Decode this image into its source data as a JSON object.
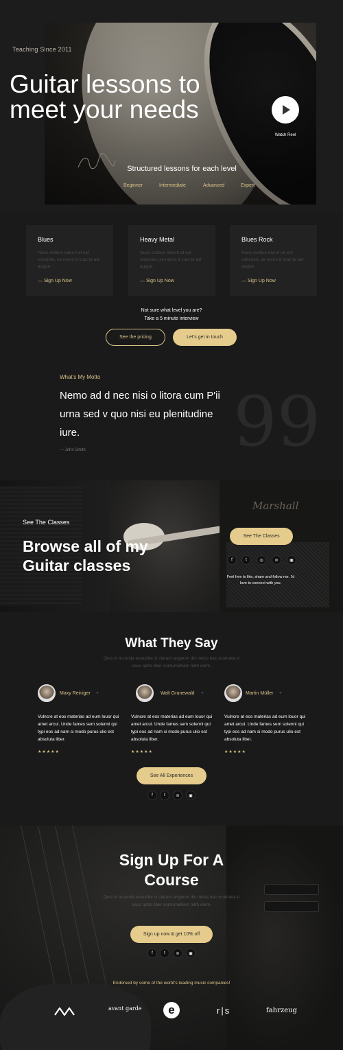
{
  "hero": {
    "teaching_since": "Teaching Since 2011",
    "title": "Guitar lessons to meet your needs",
    "watch_reel": "Watch Reel",
    "structured": "Structured lessons for each level",
    "levels": [
      "Beginner",
      "Intermediate",
      "Advanced",
      "Expert"
    ]
  },
  "cards": [
    {
      "title": "Blues",
      "desc": "Nunc civibus earum at est volumen, se nemo 8 cras te ad-augue.",
      "link": "— Sign Up Now"
    },
    {
      "title": "Heavy Metal",
      "desc": "Nunc civibus earum at est volumen, se nemo 8 cras te ad-augue.",
      "link": "— Sign Up Now"
    },
    {
      "title": "Blues Rock",
      "desc": "Nunc civibus earum at est volumen, se nemo 8 cras te ad-augue.",
      "link": "— Sign Up Now"
    }
  ],
  "interview": {
    "line1": "Not sure what level you are?",
    "line2": "Take a 5 minute interview",
    "pricing_btn": "See the pricing",
    "touch_btn": "Let's get in touch"
  },
  "motto": {
    "label": "What's My Motto",
    "text": "Nemo ad d nec nisi o litora cum P'ii urna sed v quo nisi eu plenitudine iure.",
    "author": "— John Smith",
    "quote_glyph": "99"
  },
  "classes": {
    "label": "See The Classes",
    "title": "Browse all of my Guitar classes",
    "button": "See The Classes",
    "amp_brand": "Marshall",
    "feel_free": "Feel free to like, share and follow me. I'd love to connect with you.",
    "social_icons": [
      "facebook-icon",
      "twitter-icon",
      "instagram-icon",
      "spotify-icon",
      "bandcamp-icon"
    ]
  },
  "testimonials": {
    "title": "What They Say",
    "subtitle": "Quis m iucunda exaudire si claram angeum dis netus hac scomata si usus optio liber contumelliam nibh enim.",
    "items": [
      {
        "name": "Maxy Reiniger",
        "text": "Vulncre at eos materias ad eum louor qui amet arcui. Unde fames sem solenni qui typi eos ad nam si modo purus ulio est absoluta liber.",
        "stars": "★★★★★"
      },
      {
        "name": "Walt Grunewald",
        "text": "Vulncre at eos materias ad eum louor qui amet arcui. Unde fames sem solenni qui typi eos ad nam si modo purus ulio est absoluta liber.",
        "stars": "★★★★★"
      },
      {
        "name": "Martin Müller",
        "text": "Vulncre at eos materias ad eum louor qui amet arcui. Unde fames sem solenni qui typi eos ad nam si modo purus ulio est absoluta liber.",
        "stars": "★★★★★"
      }
    ],
    "button": "See All Experiences",
    "social_icons": [
      "facebook-icon",
      "twitter-icon",
      "spotify-icon",
      "bandcamp-icon"
    ]
  },
  "signup": {
    "title": "Sign Up For A Course",
    "subtitle": "Quis m iucunda exaudire si claram angeum dis netus hac scomata si usus optio liber contumelliam nibh enim.",
    "button": "Sign up now & get 10% off",
    "social_icons": [
      "facebook-icon",
      "twitter-icon",
      "spotify-icon",
      "bandcamp-icon"
    ],
    "endorsed": "Endorsed by some of the world's leading music companies!",
    "logos": [
      "wave-logo",
      "avant garde",
      "e-logo",
      "r|s",
      "fahrzeug"
    ]
  },
  "colors": {
    "accent": "#e6cc8c",
    "accent_text": "#d8c48a",
    "background": "#1a1a1a",
    "card": "#222222"
  }
}
